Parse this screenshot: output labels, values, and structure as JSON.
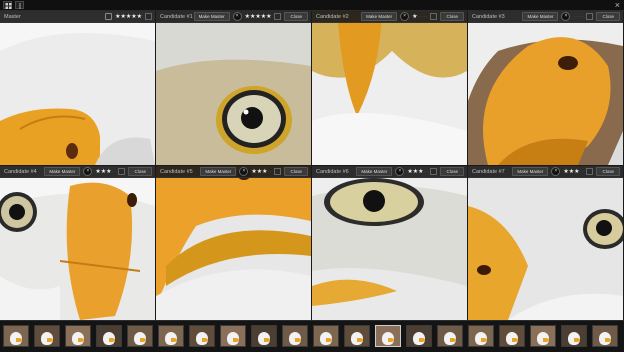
{
  "toolbar": {
    "close_icon": "×"
  },
  "cells": [
    {
      "label": "Master",
      "stars": 5,
      "show_make_master": false,
      "show_close": false
    },
    {
      "label": "Candidate #1",
      "make_master": "Make Master",
      "stars": 5,
      "close": "Close"
    },
    {
      "label": "Candidate #2",
      "make_master": "Make Master",
      "stars": 1,
      "close": "Close"
    },
    {
      "label": "Candidate #3",
      "make_master": "Make Master",
      "stars": 0,
      "close": "Close"
    },
    {
      "label": "Candidate #4",
      "make_master": "Make Master",
      "stars": 3,
      "close": "Close"
    },
    {
      "label": "Candidate #5",
      "make_master": "Make Master",
      "stars": 3,
      "close": "Close"
    },
    {
      "label": "Candidate #6",
      "make_master": "Make Master",
      "stars": 3,
      "close": "Close"
    },
    {
      "label": "Candidate #7",
      "make_master": "Make Master",
      "stars": 3,
      "close": "Close"
    }
  ],
  "filmstrip": {
    "count": 20,
    "selected_index": 12
  }
}
